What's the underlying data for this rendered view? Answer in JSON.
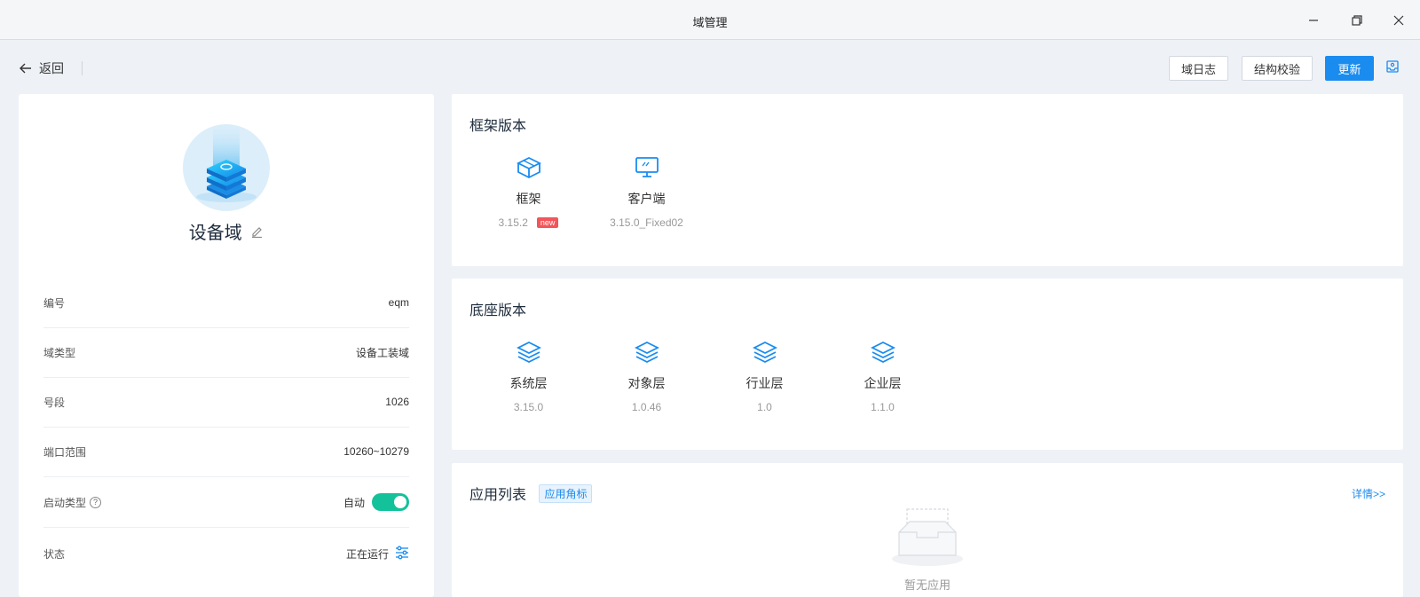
{
  "window": {
    "title": "域管理"
  },
  "toolbar": {
    "back_label": "返回",
    "log_button": "域日志",
    "check_button": "结构校验",
    "update_button": "更新"
  },
  "domain": {
    "name": "设备域",
    "fields": [
      {
        "label": "编号",
        "value": "eqm"
      },
      {
        "label": "域类型",
        "value": "设备工装域"
      },
      {
        "label": "号段",
        "value": "1026"
      },
      {
        "label": "端口范围",
        "value": "10260~10279"
      },
      {
        "label": "启动类型",
        "value": "自动"
      },
      {
        "label": "状态",
        "value": "正在运行"
      }
    ]
  },
  "framework": {
    "title": "框架版本",
    "items": [
      {
        "name": "框架",
        "version": "3.15.2",
        "badge": "new",
        "icon": "cube-icon"
      },
      {
        "name": "客户端",
        "version": "3.15.0_Fixed02",
        "icon": "monitor-icon"
      }
    ]
  },
  "base": {
    "title": "底座版本",
    "items": [
      {
        "name": "系统层",
        "version": "3.15.0",
        "icon": "layers-icon"
      },
      {
        "name": "对象层",
        "version": "1.0.46",
        "icon": "layers-icon"
      },
      {
        "name": "行业层",
        "version": "1.0",
        "icon": "layers-icon"
      },
      {
        "name": "企业层",
        "version": "1.1.0",
        "icon": "layers-icon"
      }
    ]
  },
  "apps": {
    "title": "应用列表",
    "badge": "应用角标",
    "detail_link": "详情>>",
    "empty_text": "暂无应用"
  },
  "colors": {
    "primary": "#1a8cf0",
    "toggle_on": "#13c29a",
    "new_tag": "#f2555a",
    "background": "#eef1f6"
  }
}
